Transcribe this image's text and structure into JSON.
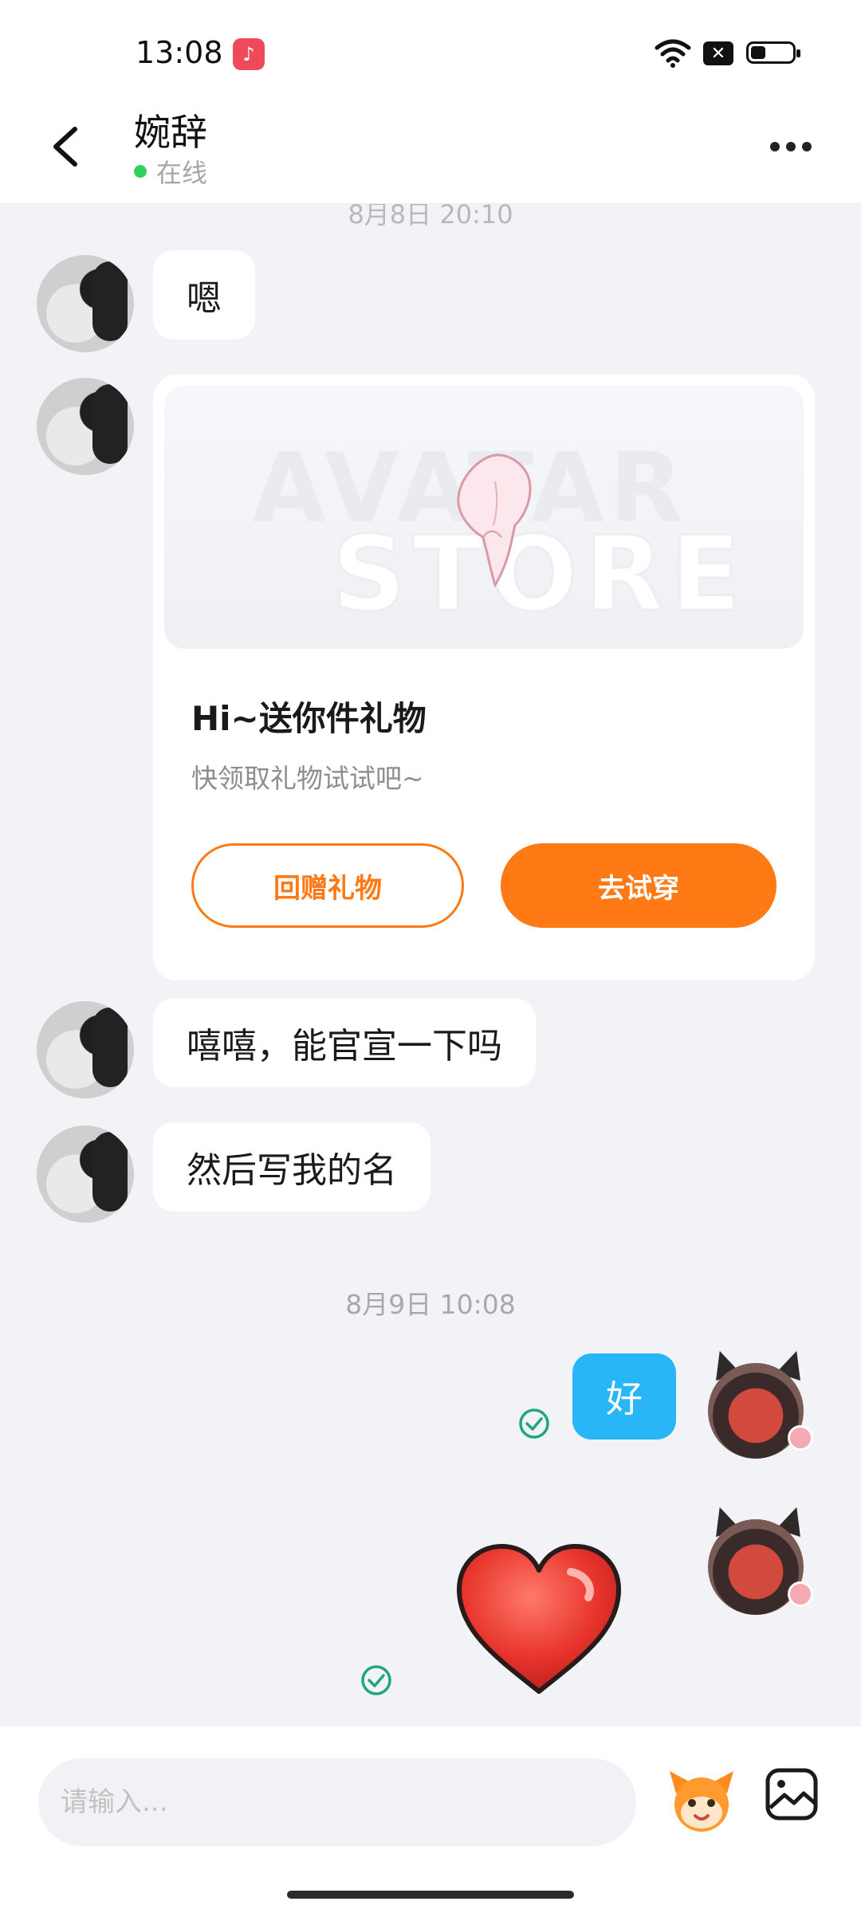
{
  "status_bar": {
    "time": "13:08",
    "icons": [
      "music-app-icon",
      "wifi-icon",
      "close-icon",
      "battery-icon"
    ]
  },
  "header": {
    "contact_name": "婉辞",
    "status": "在线",
    "status_color": "#2fd15b"
  },
  "chat": {
    "top_timestamp": "8月8日 20:10",
    "messages_incoming": [
      {
        "text": "嗯"
      },
      {
        "text": "嘻嘻，能官宣一下吗"
      },
      {
        "text": "然后写我的名"
      }
    ],
    "gift_card": {
      "banner_text_1": "AVATAR",
      "banner_text_2": "STORE",
      "title": "Hi~送你件礼物",
      "subtitle": "快领取礼物试试吧~",
      "return_gift_label": "回赠礼物",
      "try_on_label": "去试穿",
      "accent_color": "#ff7a14"
    },
    "timestamp_2": "8月9日 10:08",
    "messages_outgoing": [
      {
        "text": "好",
        "color": "#29b6f6"
      },
      {
        "sticker": "heart"
      }
    ]
  },
  "input_bar": {
    "placeholder": "请输入..."
  }
}
